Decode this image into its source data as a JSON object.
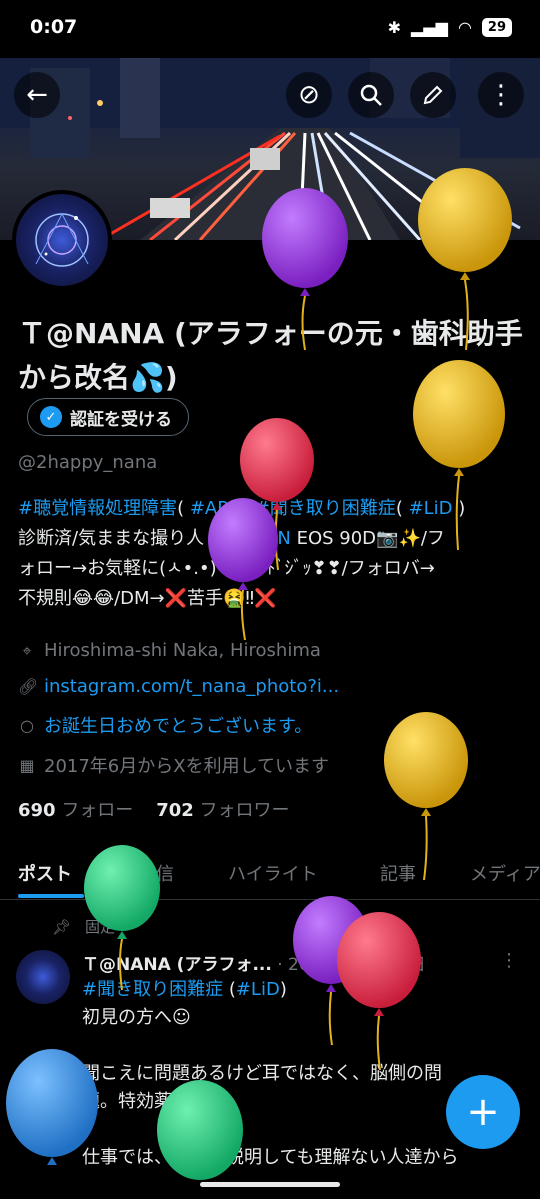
{
  "status": {
    "time": "0:07",
    "battery": "29"
  },
  "profile": {
    "name": "Ｔ@NANA (アラフォーの元・歯科助手から改名💦)",
    "verify_label": "認証を受ける",
    "handle": "@2happy_nana",
    "bio_lines": [
      {
        "tag": "#聴覚情報処理障害",
        "text1": "( ",
        "tag2": "#APD",
        "text2": " )",
        "tag3": "#聞き取り困難症",
        "text3": "( ",
        "tag4": "#LiD",
        "text4": " )"
      },
      {
        "text": "診断済/気ままな撮り人 ",
        "tag": "#CANON",
        "text2": " EOS 90D📷✨/フ"
      },
      {
        "text": "ォロー→お気軽に(ㅅ•.•)♡*.+ﾟﾄﾞｼﾞｯ❣❣/フォロバ→"
      },
      {
        "text": "不規則😂😂/DM→❌苦手🤮‼❌"
      }
    ],
    "location": "Hiroshima-shi Naka, Hiroshima",
    "link": "instagram.com/t_nana_photo?i...",
    "birthday": "お誕生日おめでとうございます。",
    "joined": "2017年6月からXを利用しています",
    "following_count": "690",
    "following_label": "フォロー",
    "followers_count": "702",
    "followers_label": "フォロワー"
  },
  "tabs": [
    "ポスト",
    "返信",
    "ハイライト",
    "記事",
    "メディア"
  ],
  "pinned_post": {
    "pinned_label": "固定",
    "name": "Ｔ@NANA (アラフォ...",
    "date": "· 2023年08月21日",
    "tag1": "#聞き取り困難症",
    "tag1_suffix_open": " (",
    "tag2": "#LiD",
    "tag2_suffix": ")",
    "line2": "初見の方へ☺",
    "line3": "聞こえに問題あるけど耳ではなく、脳側の問",
    "line4": "題。特効薬はない",
    "line5": "仕事では、症状を説明しても理解ない人達から"
  },
  "fab_label": "+",
  "icons": {
    "back": "back-arrow-icon",
    "circle": "circle-slash-icon",
    "search": "search-icon",
    "edit": "pencil-icon",
    "more": "more-vertical-icon"
  },
  "balloon_colors": [
    "#8e2fd0",
    "#e2b21d",
    "#e2364f",
    "#27c97e",
    "#2f8ee0"
  ]
}
